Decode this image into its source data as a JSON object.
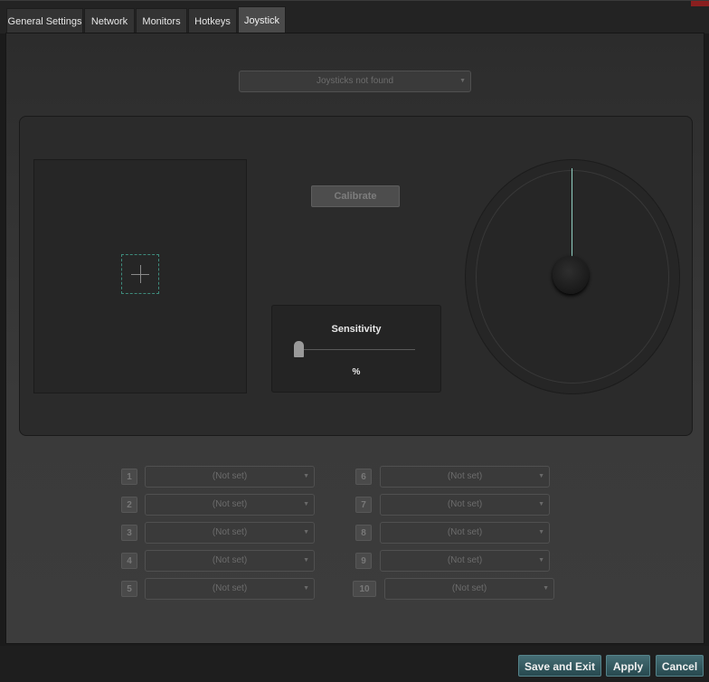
{
  "tabs": [
    {
      "label": "General Settings"
    },
    {
      "label": "Network"
    },
    {
      "label": "Monitors"
    },
    {
      "label": "Hotkeys"
    },
    {
      "label": "Joystick",
      "active": true
    }
  ],
  "joystick_select": {
    "value": "Joysticks not found"
  },
  "calibrate_label": "Calibrate",
  "sensitivity": {
    "title": "Sensitivity",
    "unit": "%",
    "level": 0
  },
  "slots_left": [
    {
      "num": "1",
      "value": "(Not set)"
    },
    {
      "num": "2",
      "value": "(Not set)"
    },
    {
      "num": "3",
      "value": "(Not set)"
    },
    {
      "num": "4",
      "value": "(Not set)"
    },
    {
      "num": "5",
      "value": "(Not set)"
    }
  ],
  "slots_right": [
    {
      "num": "6",
      "value": "(Not set)"
    },
    {
      "num": "7",
      "value": "(Not set)"
    },
    {
      "num": "8",
      "value": "(Not set)"
    },
    {
      "num": "9",
      "value": "(Not set)"
    },
    {
      "num": "10",
      "value": "(Not set)"
    }
  ],
  "buttons": {
    "save_exit": "Save and Exit",
    "apply": "Apply",
    "cancel": "Cancel"
  },
  "colors": {
    "accent": "#3e6b72",
    "crosshair_dash": "#3e8b7c",
    "needle": "#8fcfc1"
  }
}
